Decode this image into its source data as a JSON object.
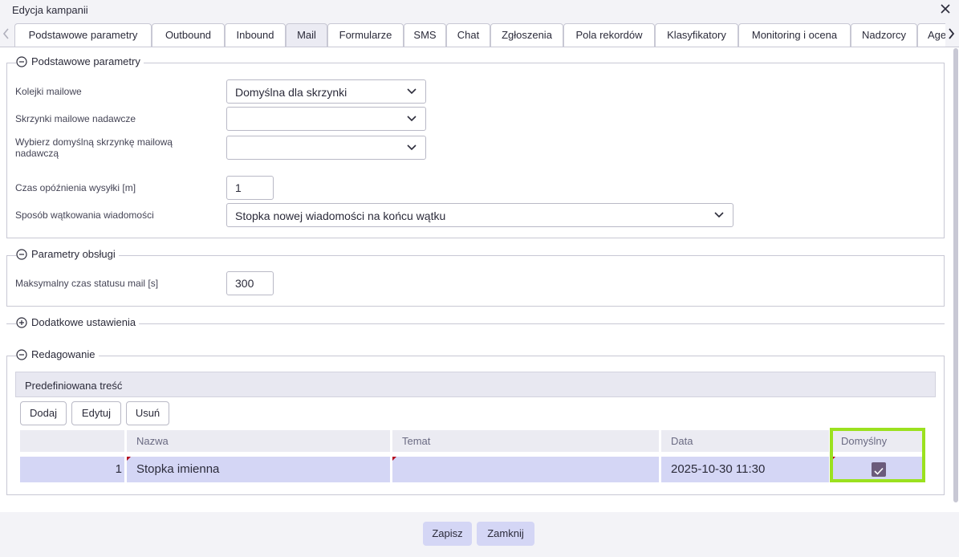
{
  "window": {
    "title": "Edycja kampanii"
  },
  "tabs": [
    {
      "label": "Podstawowe parametry"
    },
    {
      "label": "Outbound"
    },
    {
      "label": "Inbound"
    },
    {
      "label": "Mail"
    },
    {
      "label": "Formularze"
    },
    {
      "label": "SMS"
    },
    {
      "label": "Chat"
    },
    {
      "label": "Zgłoszenia"
    },
    {
      "label": "Pola rekordów"
    },
    {
      "label": "Klasyfikatory"
    },
    {
      "label": "Monitoring i ocena"
    },
    {
      "label": "Nadzorcy"
    },
    {
      "label": "Age"
    }
  ],
  "active_tab": "Mail",
  "sections": {
    "basic": {
      "legend": "Podstawowe parametry",
      "fields": {
        "mail_queues": {
          "label": "Kolejki mailowe",
          "value": "Domyślna dla skrzynki"
        },
        "sender_boxes": {
          "label": "Skrzynki mailowe nadawcze",
          "value": ""
        },
        "default_sender_box": {
          "label": "Wybierz domyślną skrzynkę mailową nadawczą",
          "value": ""
        },
        "send_delay": {
          "label": "Czas opóźnienia wysyłki [m]",
          "value": "1"
        },
        "threading": {
          "label": "Sposób wątkowania wiadomości",
          "value": "Stopka nowej wiadomości na końcu wątku"
        }
      }
    },
    "handling": {
      "legend": "Parametry obsługi",
      "fields": {
        "max_status_time": {
          "label": "Maksymalny czas statusu mail [s]",
          "value": "300"
        }
      }
    },
    "additional": {
      "legend": "Dodatkowe ustawienia"
    },
    "editing": {
      "legend": "Redagowanie",
      "grid_title": "Predefiniowana treść",
      "buttons": {
        "add": "Dodaj",
        "edit": "Edytuj",
        "delete": "Usuń"
      },
      "columns": [
        "",
        "Nazwa",
        "Temat",
        "Data",
        "Domyślny"
      ],
      "rows": [
        {
          "num": "1",
          "name": "Stopka imienna",
          "subject": "",
          "date": "2025-10-30 11:30",
          "default": true
        }
      ]
    }
  },
  "footer": {
    "save": "Zapisz",
    "close": "Zamknij"
  },
  "colors": {
    "accent": "#d4d6f5",
    "highlight": "#9be11f",
    "checkbox": "#6b5b7b"
  }
}
